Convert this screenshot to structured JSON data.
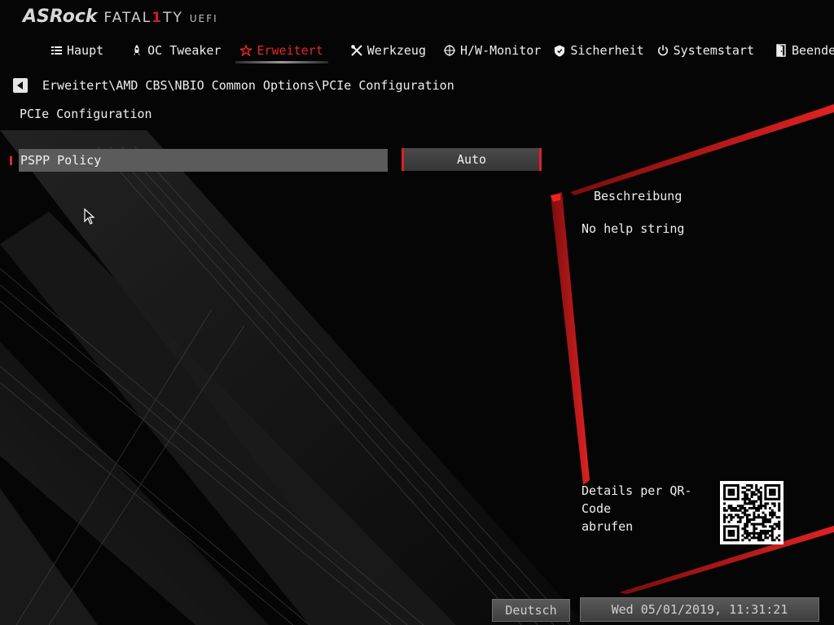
{
  "logo": {
    "brand": "ASRock",
    "series_pre": "FATAL",
    "series_one": "1",
    "series_post": "TY",
    "suffix": "UEFI"
  },
  "menu": [
    {
      "label": "Haupt",
      "icon": "list-icon",
      "active": false
    },
    {
      "label": "OC Tweaker",
      "icon": "rocket-icon",
      "active": false
    },
    {
      "label": "Erweitert",
      "icon": "star-icon",
      "active": true
    },
    {
      "label": "Werkzeug",
      "icon": "tools-icon",
      "active": false
    },
    {
      "label": "H/W-Monitor",
      "icon": "crosshair-icon",
      "active": false
    },
    {
      "label": "Sicherheit",
      "icon": "shield-icon",
      "active": false
    },
    {
      "label": "Systemstart",
      "icon": "power-icon",
      "active": false
    },
    {
      "label": "Beenden",
      "icon": "exit-door-icon",
      "active": false
    }
  ],
  "breadcrumb": "Erweitert\\AMD CBS\\NBIO Common Options\\PCIe Configuration",
  "page_title": "PCIe Configuration",
  "options": [
    {
      "label": "PSPP Policy",
      "value": "Auto"
    }
  ],
  "description": {
    "title": "Beschreibung",
    "text": "No help string",
    "qr_line1": "Details per QR-Code",
    "qr_line2": "abrufen"
  },
  "statusbar": {
    "language": "Deutsch",
    "datetime": "Wed 05/01/2019, 11:31:21"
  },
  "colors": {
    "accent": "#e32626",
    "selection_bar": "#5b5b5b",
    "background": "#050505"
  }
}
